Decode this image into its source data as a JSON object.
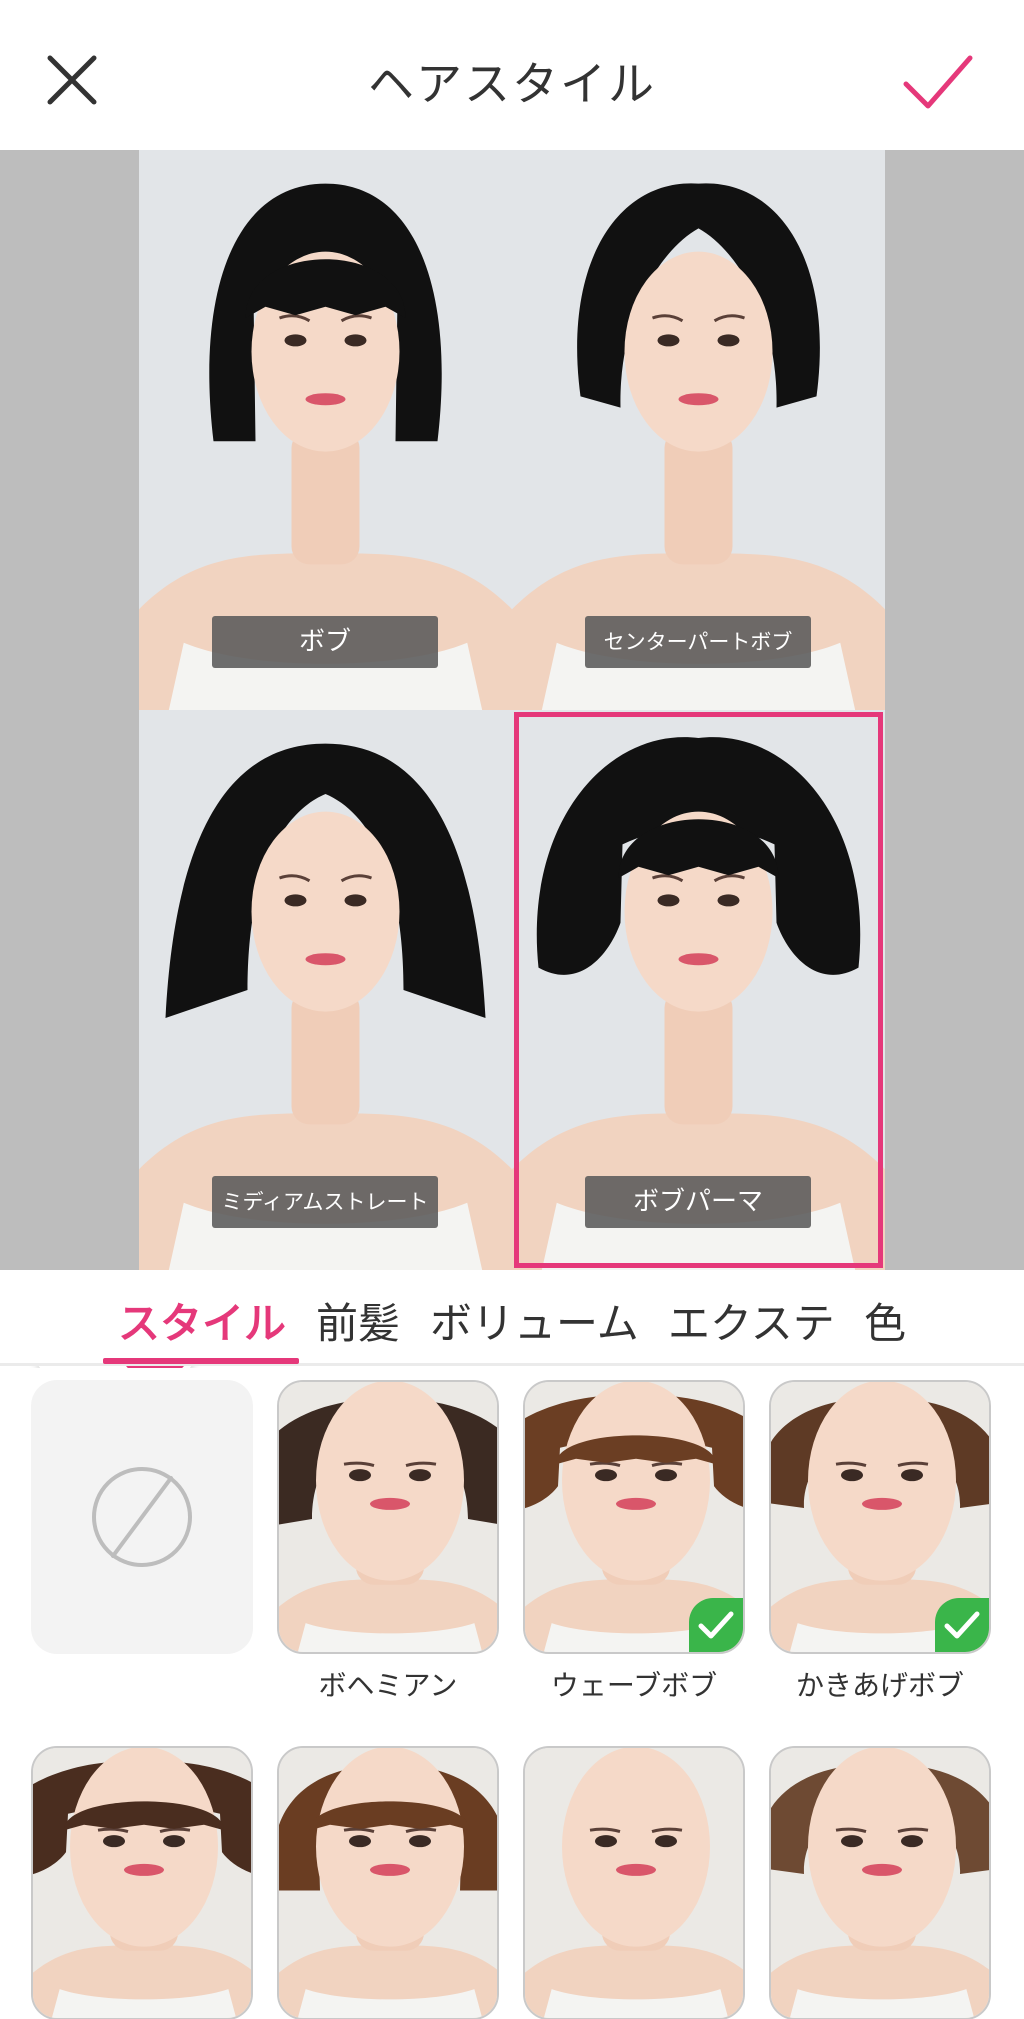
{
  "header": {
    "title": "ヘアスタイル"
  },
  "preview": {
    "cells": [
      {
        "label": "ボブ",
        "hair": "bob",
        "selected": false
      },
      {
        "label": "センターパートボブ",
        "hair": "center-part-bob",
        "selected": false
      },
      {
        "label": "ミディアムストレート",
        "hair": "medium-straight",
        "selected": false
      },
      {
        "label": "ボブパーマ",
        "hair": "bob-perm",
        "selected": true
      }
    ]
  },
  "tabs": [
    {
      "label": "スタイル",
      "active": true
    },
    {
      "label": "前髪",
      "active": false
    },
    {
      "label": "ボリューム",
      "active": false
    },
    {
      "label": "エクステ",
      "active": false
    },
    {
      "label": "色",
      "active": false
    }
  ],
  "options": {
    "row1": [
      {
        "label": "",
        "type": "none",
        "icon": "none-icon"
      },
      {
        "label": "ボヘミアン",
        "checked": false
      },
      {
        "label": "ウェーブボブ",
        "checked": true
      },
      {
        "label": "かきあげボブ",
        "checked": true
      }
    ],
    "row2": [
      {
        "label": ""
      },
      {
        "label": ""
      },
      {
        "label": ""
      },
      {
        "label": ""
      }
    ]
  },
  "colors": {
    "accent": "#e5387a",
    "check": "#3ab54a",
    "background": "#bdbdbd"
  }
}
